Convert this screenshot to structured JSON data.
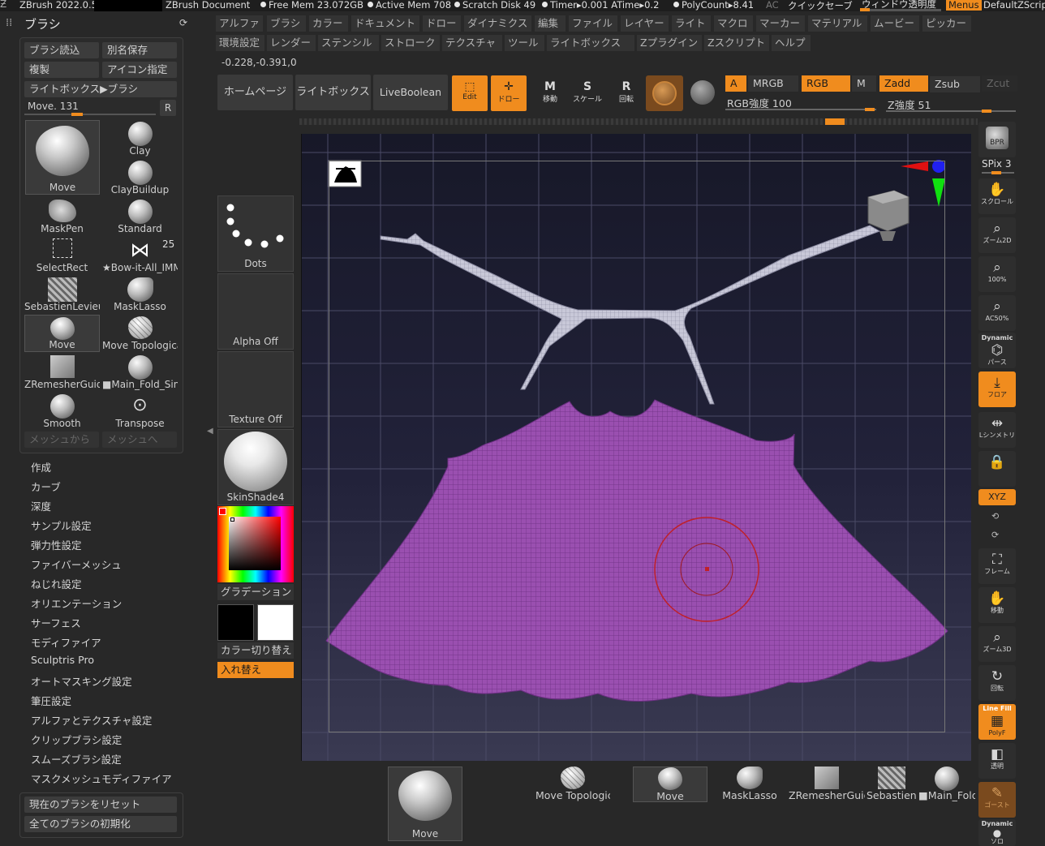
{
  "titlebar": {
    "app": "ZBrush 2022.0.5",
    "doc": "ZBrush Document",
    "freemem": "Free Mem 23.072GB",
    "activemem": "Active Mem 708",
    "scratch": "Scratch Disk 49",
    "timer": "Timer▸0.001 ATime▸0.2",
    "polycount": "PolyCount▸8.41",
    "ac": "AC",
    "quicksave": "クイックセーブ",
    "transparency": "ウィンドウ透明度",
    "menus": "Menus",
    "script": "DefaultZScript"
  },
  "menubar": {
    "row1": [
      "アルファ",
      "ブラシ",
      "カラー",
      "ドキュメント",
      "ドロー",
      "ダイナミクス",
      "編集",
      "ファイル",
      "レイヤー",
      "ライト",
      "マクロ",
      "マーカー",
      "マテリアル",
      "ムービー",
      "ピッカー"
    ],
    "row2": [
      "環境設定",
      "レンダー",
      "ステンシル",
      "ストローク",
      "テクスチャ",
      "ツール",
      "ライトボックス",
      "Zプラグイン",
      "Zスクリプト",
      "ヘルプ"
    ],
    "coords": "-0.228,-0.391,0"
  },
  "brush_panel": {
    "title": "ブラシ",
    "load": "ブラシ読込",
    "saveas": "別名保存",
    "clone": "複製",
    "icon": "アイコン指定",
    "lightbox": "ライトボックス▶ブラシ",
    "slider_label": "Move. 131",
    "slider_value": 131,
    "r": "R",
    "current": "Move",
    "brushes": [
      "Clay",
      "ClayBuildup",
      "MaskPen",
      "Standard",
      "SelectRect",
      "★Bow-it-All_IMM",
      "SebastienLevieu",
      "MaskLasso",
      "Move",
      "Move Topologica",
      "ZRemesherGuide",
      "■Main_Fold_Sin",
      "Smooth",
      "Transpose"
    ],
    "count": "25",
    "from_mesh": "メッシュから",
    "to_mesh": "メッシュへ",
    "list": [
      "作成",
      "カーブ",
      "深度",
      "サンプル設定",
      "弾力性設定",
      "ファイバーメッシュ",
      "ねじれ設定",
      "オリエンテーション",
      "サーフェス",
      "モディファイア",
      "Sculptris Pro",
      "オートマスキング設定",
      "筆圧設定",
      "アルファとテクスチャ設定",
      "クリップブラシ設定",
      "スムーズブラシ設定",
      "マスクメッシュモディファイア"
    ],
    "reset": "現在のブラシをリセット",
    "init_all": "全てのブラシの初期化"
  },
  "shelf": {
    "home": "ホームページ",
    "lightbox": "ライトボックス",
    "liveboolean": "LiveBoolean",
    "edit": "Edit",
    "draw": "ドロー",
    "move": "移動",
    "scale": "スケール",
    "rotate": "回転",
    "move_key": "M",
    "scale_key": "S",
    "rotate_key": "R",
    "a": "A",
    "mrgb": "MRGB",
    "rgb": "RGB",
    "m": "M",
    "zadd": "Zadd",
    "zsub": "Zsub",
    "zcut": "Zcut",
    "rgb_intensity": "RGB強度 100",
    "z_intensity": "Z強度 51"
  },
  "left_tools": {
    "stroke": "Dots",
    "alpha": "Alpha Off",
    "texture": "Texture Off",
    "material": "SkinShade4",
    "gradient": "グラデーション",
    "switch_color": "カラー切り替え",
    "swap": "入れ替え"
  },
  "right_toolbar": {
    "bpr": "BPR",
    "spix": "SPix 3",
    "scroll": "スクロール",
    "zoom2d": "ズーム2D",
    "hundred": "100%",
    "ac50": "AC50%",
    "dynamic": "Dynamic",
    "perspective": "パース",
    "floor": "フロア",
    "symmetry": "Lシンメトリ",
    "xyz": "XYZ",
    "frame": "フレーム",
    "move": "移動",
    "zoom3d": "ズーム3D",
    "rotate": "回転",
    "linefill": "Line Fill",
    "polyf": "PolyF",
    "transparent": "透明",
    "ghost": "ゴースト",
    "dynamic2": "Dynamic",
    "solo": "ソロ"
  },
  "bottom_shelf": [
    "Move",
    "Move Topologica",
    "Move",
    "MaskLasso",
    "ZRemesherGuide",
    "SebastienLe",
    "■Main_Fold"
  ],
  "colors": {
    "accent": "#f08c1e",
    "mesh_purple": "#9a4fb0",
    "mesh_gray": "#c8c8d8",
    "canvas_bg": "#1c1c2e"
  }
}
